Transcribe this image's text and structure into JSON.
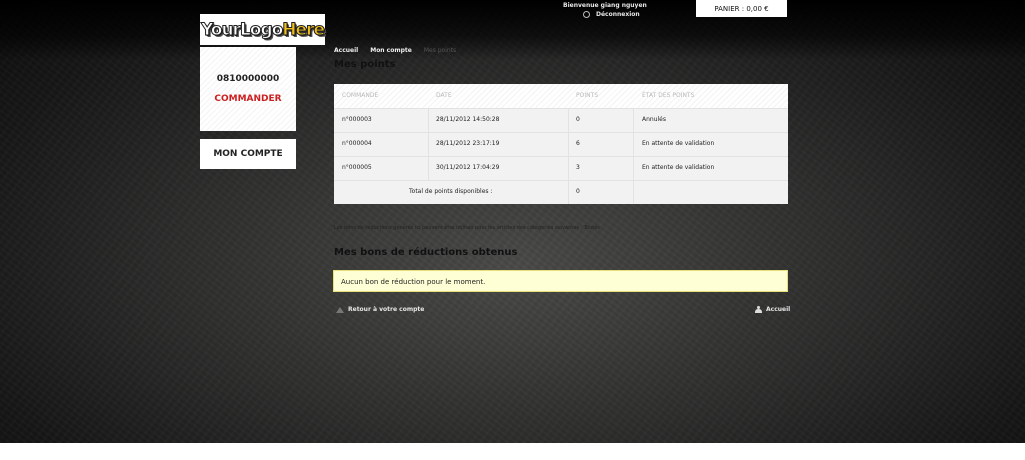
{
  "header": {
    "logo_text_a": "YourLogo",
    "logo_text_b": "Here",
    "welcome": "Bienvenue giang nguyen",
    "logout": "Déconnexion",
    "cart": "PANIER : 0,00 €"
  },
  "sidebar": {
    "phone": "0810000000",
    "order": "COMMANDER",
    "account": "MON COMPTE"
  },
  "breadcrumb": [
    "Accueil",
    "Mon compte",
    "Mes points"
  ],
  "page_title": "Mes points",
  "table": {
    "columns": [
      "COMMANDE",
      "DATE",
      "POINTS",
      "ÉTAT DES POINTS"
    ],
    "rows": [
      {
        "order": "n°000003",
        "date": "28/11/2012 14:50:28",
        "points": "0",
        "status": "Annulés"
      },
      {
        "order": "n°000004",
        "date": "28/11/2012 23:17:19",
        "points": "6",
        "status": "En attente de validation"
      },
      {
        "order": "n°000005",
        "date": "30/11/2012 17:04:29",
        "points": "3",
        "status": "En attente de validation"
      }
    ],
    "total_label": "Total de points disponibles :",
    "total_value": "0"
  },
  "note": "Les bons de réductions générés ici peuvent être utilisés pour les articles des catégories suivantes : Toutes",
  "vouchers_title": "Mes bons de réductions obtenus",
  "vouchers_empty": "Aucun bon de réduction pour le moment.",
  "footer_links": {
    "back": "Retour à votre compte",
    "home": "Accueil"
  },
  "colors": {
    "accent_red": "#cc1f1f",
    "logo_yellow": "#f3c01a",
    "notice_bg": "#ffffd6"
  }
}
